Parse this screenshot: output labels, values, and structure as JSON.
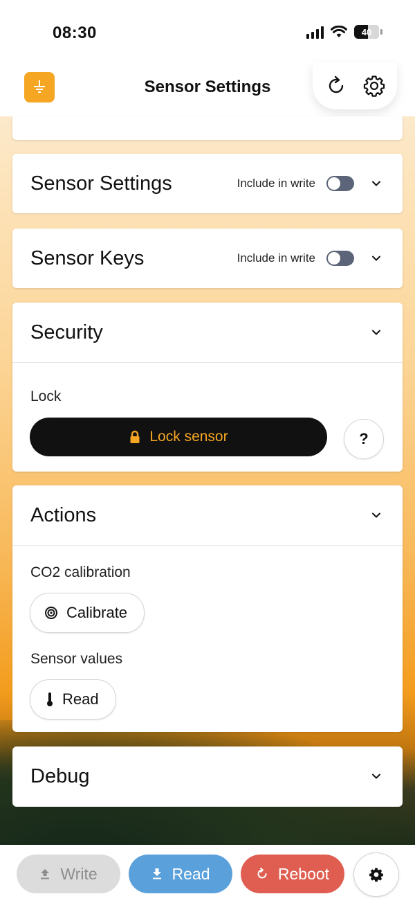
{
  "status_bar": {
    "time": "08:30",
    "battery": "40"
  },
  "header": {
    "title": "Sensor Settings"
  },
  "cards": {
    "sensor_settings": {
      "title": "Sensor Settings",
      "include_label": "Include in write"
    },
    "sensor_keys": {
      "title": "Sensor Keys",
      "include_label": "Include in write"
    },
    "security": {
      "title": "Security",
      "lock_label": "Lock",
      "lock_button": "Lock sensor",
      "help_button": "?"
    },
    "actions": {
      "title": "Actions",
      "co2_label": "CO2 calibration",
      "calibrate_button": "Calibrate",
      "sensor_values_label": "Sensor values",
      "read_button": "Read"
    },
    "debug": {
      "title": "Debug"
    }
  },
  "bottom_bar": {
    "write": "Write",
    "read": "Read",
    "reboot": "Reboot"
  },
  "colors": {
    "accent": "#f5a623",
    "read": "#5aa0db",
    "reboot": "#df5e51",
    "disabled": "#dcdcdc"
  }
}
